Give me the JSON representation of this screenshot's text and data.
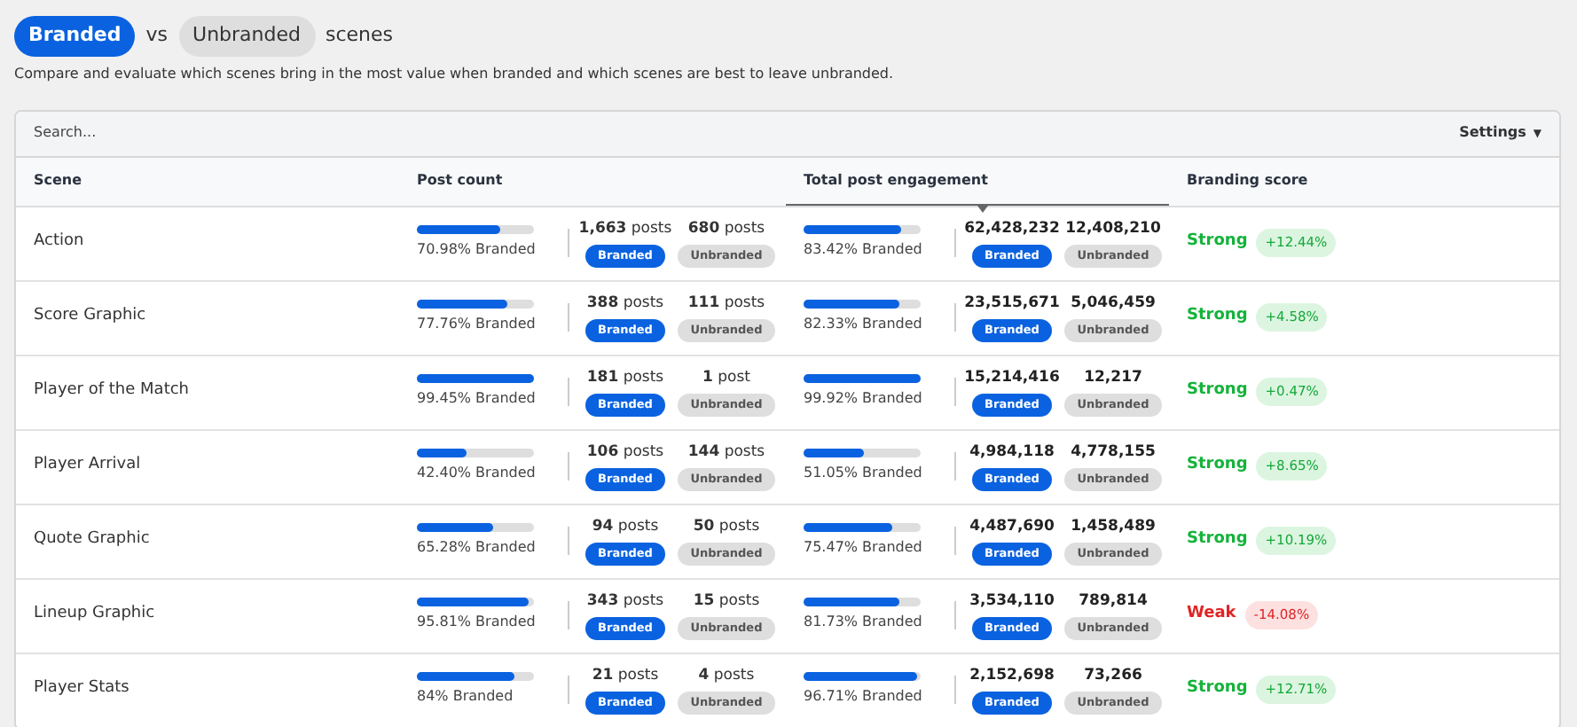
{
  "heading": {
    "branded_pill": "Branded",
    "vs": "vs",
    "unbranded_pill": "Unbranded",
    "suffix": "scenes"
  },
  "description": "Compare and evaluate which scenes bring in the most value when branded and which scenes are best to leave unbranded.",
  "search": {
    "placeholder": "Search..."
  },
  "settings": {
    "label": "Settings",
    "caret": "▼"
  },
  "columns": [
    {
      "label": "Scene",
      "sorted": false
    },
    {
      "label": "Post count",
      "sorted": false
    },
    {
      "label": "Total post engagement",
      "sorted": true
    },
    {
      "label": "Branding score",
      "sorted": false
    }
  ],
  "rows": [
    {
      "scene": "Action",
      "posts": {
        "level": 0.7098,
        "label": "70.98% Branded",
        "branded": "**1,663** posts",
        "branded_badge": "Branded",
        "unbranded": "**680** posts",
        "unbranded_badge": "Unbranded"
      },
      "engagement": {
        "level": 0.8342,
        "label": "83.42% Branded",
        "branded": "62,428,232",
        "branded_badge": "Branded",
        "unbranded": "12,408,210",
        "unbranded_badge": "Unbranded"
      },
      "score": {
        "kind": "strong",
        "label": "Strong",
        "change": "+12.44%"
      }
    },
    {
      "scene": "Score Graphic",
      "posts": {
        "level": 0.7776,
        "label": "77.76% Branded",
        "branded": "**388** posts",
        "branded_badge": "Branded",
        "unbranded": "**111** posts",
        "unbranded_badge": "Unbranded"
      },
      "engagement": {
        "level": 0.8233,
        "label": "82.33% Branded",
        "branded": "23,515,671",
        "branded_badge": "Branded",
        "unbranded": "5,046,459",
        "unbranded_badge": "Unbranded"
      },
      "score": {
        "kind": "strong",
        "label": "Strong",
        "change": "+4.58%"
      }
    },
    {
      "scene": "Player of the Match",
      "posts": {
        "level": 0.9945,
        "label": "99.45% Branded",
        "branded": "**181** posts",
        "branded_badge": "Branded",
        "unbranded": "**1** post",
        "unbranded_badge": "Unbranded"
      },
      "engagement": {
        "level": 0.9992,
        "label": "99.92% Branded",
        "branded": "15,214,416",
        "branded_badge": "Branded",
        "unbranded": "12,217",
        "unbranded_badge": "Unbranded"
      },
      "score": {
        "kind": "strong",
        "label": "Strong",
        "change": "+0.47%"
      }
    },
    {
      "scene": "Player Arrival",
      "posts": {
        "level": 0.424,
        "label": "42.40% Branded",
        "branded": "**106** posts",
        "branded_badge": "Branded",
        "unbranded": "**144** posts",
        "unbranded_badge": "Unbranded"
      },
      "engagement": {
        "level": 0.5105,
        "label": "51.05% Branded",
        "branded": "4,984,118",
        "branded_badge": "Branded",
        "unbranded": "4,778,155",
        "unbranded_badge": "Unbranded"
      },
      "score": {
        "kind": "strong",
        "label": "Strong",
        "change": "+8.65%"
      }
    },
    {
      "scene": "Quote Graphic",
      "posts": {
        "level": 0.6528,
        "label": "65.28% Branded",
        "branded": "**94** posts",
        "branded_badge": "Branded",
        "unbranded": "**50** posts",
        "unbranded_badge": "Unbranded"
      },
      "engagement": {
        "level": 0.7547,
        "label": "75.47% Branded",
        "branded": "4,487,690",
        "branded_badge": "Branded",
        "unbranded": "1,458,489",
        "unbranded_badge": "Unbranded"
      },
      "score": {
        "kind": "strong",
        "label": "Strong",
        "change": "+10.19%"
      }
    },
    {
      "scene": "Lineup Graphic",
      "posts": {
        "level": 0.9581,
        "label": "95.81% Branded",
        "branded": "**343** posts",
        "branded_badge": "Branded",
        "unbranded": "**15** posts",
        "unbranded_badge": "Unbranded"
      },
      "engagement": {
        "level": 0.8173,
        "label": "81.73% Branded",
        "branded": "3,534,110",
        "branded_badge": "Branded",
        "unbranded": "789,814",
        "unbranded_badge": "Unbranded"
      },
      "score": {
        "kind": "weak",
        "label": "Weak",
        "change": "-14.08%"
      }
    },
    {
      "scene": "Player Stats",
      "posts": {
        "level": 0.84,
        "label": "84% Branded",
        "branded": "**21** posts",
        "branded_badge": "Branded",
        "unbranded": "**4** posts",
        "unbranded_badge": "Unbranded"
      },
      "engagement": {
        "level": 0.9671,
        "label": "96.71% Branded",
        "branded": "2,152,698",
        "branded_badge": "Branded",
        "unbranded": "73,266",
        "unbranded_badge": "Unbranded"
      },
      "score": {
        "kind": "strong",
        "label": "Strong",
        "change": "+12.71%"
      }
    }
  ]
}
